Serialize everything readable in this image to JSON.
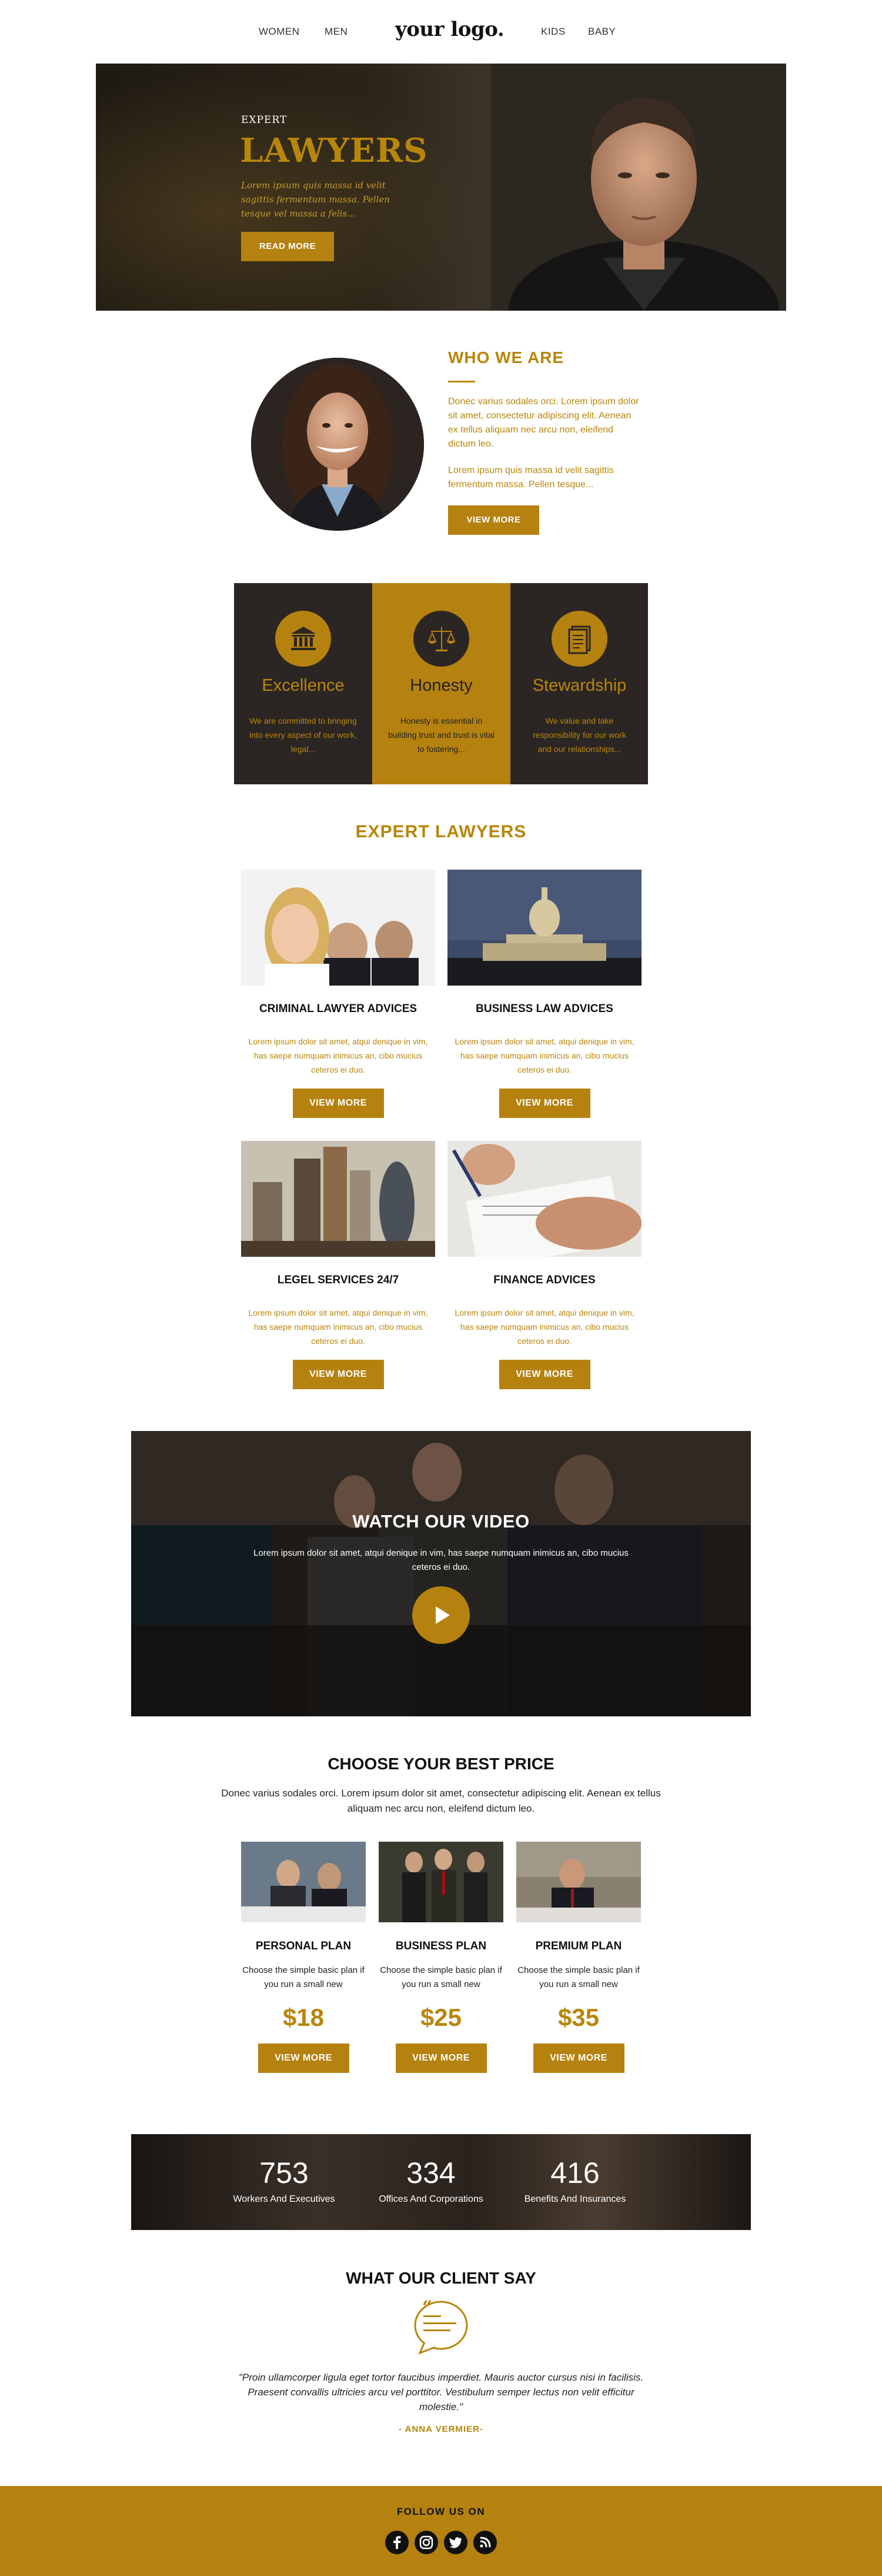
{
  "header": {
    "nav_left": [
      "WOMEN",
      "MEN"
    ],
    "logo": "your logo.",
    "nav_right": [
      "KIDS",
      "BABY"
    ]
  },
  "hero": {
    "kicker": "EXPERT",
    "title": "LAWYERS",
    "text": "Lorem ipsum quis massa id velit sagittis fermentum massa. Pellen tesque vel massa a felis...",
    "button": "READ MORE"
  },
  "who": {
    "title": "WHO WE ARE",
    "para1": "Donec varius sodales orci. Lorem ipsum dolor sit amet, consectetur adipiscing elit. Aenean ex tellus aliquam nec arcu non, eleifend dictum leo.",
    "para2": "Lorem ipsum quis massa id velit sagittis fermentum massa. Pellen tesque...",
    "button": "VIEW MORE"
  },
  "values": [
    {
      "icon": "bank-icon",
      "title": "Excellence",
      "text": "We are committed to bringing into every aspect of our work, legal..."
    },
    {
      "icon": "scales-icon",
      "title": "Honesty",
      "text": "Honesty is essential in building trust and trust is vital to fostering..."
    },
    {
      "icon": "document-icon",
      "title": "Stewardship",
      "text": "We value and take responsibility for our work and our relationships..."
    }
  ],
  "expert": {
    "title": "EXPERT LAWYERS",
    "cards": [
      {
        "title": "CRIMINAL LAWYER ADVICES",
        "text": "Lorem ipsum dolor sit amet, atqui denique in vim, has saepe numquam inimicus an, cibo mucius ceteros ei duo.",
        "button": "VIEW MORE"
      },
      {
        "title": "BUSINESS LAW ADVICES",
        "text": "Lorem ipsum dolor sit amet, atqui denique in vim, has saepe numquam inimicus an, cibo mucius ceteros ei duo.",
        "button": "VIEW MORE"
      },
      {
        "title": "LEGEL SERVICES 24/7",
        "text": "Lorem ipsum dolor sit amet, atqui denique in vim, has saepe numquam inimicus an, cibo mucius ceteros ei duo.",
        "button": "VIEW MORE"
      },
      {
        "title": "FINANCE ADVICES",
        "text": "Lorem ipsum dolor sit amet, atqui denique in vim, has saepe numquam inimicus an, cibo mucius ceteros ei duo.",
        "button": "VIEW MORE"
      }
    ]
  },
  "video": {
    "title": "WATCH OUR VIDEO",
    "text": "Lorem ipsum dolor sit amet, atqui denique in vim, has saepe numquam inimicus an, cibo mucius ceteros ei duo."
  },
  "pricing": {
    "title": "CHOOSE YOUR BEST PRICE",
    "subtitle": "Donec varius sodales orci. Lorem ipsum dolor sit amet, consectetur adipiscing elit. Aenean ex tellus aliquam nec arcu non, eleifend dictum leo.",
    "plans": [
      {
        "name": "PERSONAL PLAN",
        "desc": "Choose the simple basic plan if you run a small new",
        "price": "$18",
        "button": "VIEW MORE"
      },
      {
        "name": "BUSINESS PLAN",
        "desc": "Choose the simple basic plan if you run a small new",
        "price": "$25",
        "button": "VIEW MORE"
      },
      {
        "name": "PREMIUM PLAN",
        "desc": "Choose the simple basic plan if you run a small new",
        "price": "$35",
        "button": "VIEW MORE"
      }
    ]
  },
  "stats": [
    {
      "value": "753",
      "label": "Workers And Executives"
    },
    {
      "value": "334",
      "label": "Offices And Corporations"
    },
    {
      "value": "416",
      "label": "Benefits And Insurances"
    }
  ],
  "testimonial": {
    "title": "WHAT OUR CLIENT SAY",
    "quote": "\"Proin ullamcorper ligula eget tortor faucibus imperdiet. Mauris auctor cursus nisi in facilisis. Praesent convallis ultricies arcu vel porttitor. Vestibulum semper lectus non velit efficitur molestie.\"",
    "author": "- ANNA VERMIER-"
  },
  "footer": {
    "follow": "FOLLOW  US  ON",
    "social": [
      "facebook-icon",
      "instagram-icon",
      "twitter-icon",
      "rss-icon"
    ]
  },
  "colors": {
    "accent": "#B8860B",
    "dark": "#2B2623",
    "footer": "#B5810F"
  }
}
